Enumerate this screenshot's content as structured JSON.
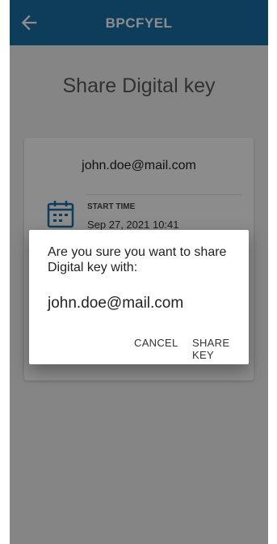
{
  "appbar": {
    "title": "BPCFYEL",
    "back_icon": "arrow-left-icon"
  },
  "page": {
    "title": "Share Digital key"
  },
  "card": {
    "email": "john.doe@mail.com",
    "start_label": "START TIME",
    "start_value": "Sep 27, 2021 10:41",
    "calendar_icon": "calendar-icon"
  },
  "dialog": {
    "message": "Are you sure you want to share Digital key with:",
    "email": "john.doe@mail.com",
    "cancel_label": "CANCEL",
    "share_label": "SHARE KEY"
  },
  "colors": {
    "brand": "#1a6fa6",
    "icon": "#1a6fa6"
  }
}
